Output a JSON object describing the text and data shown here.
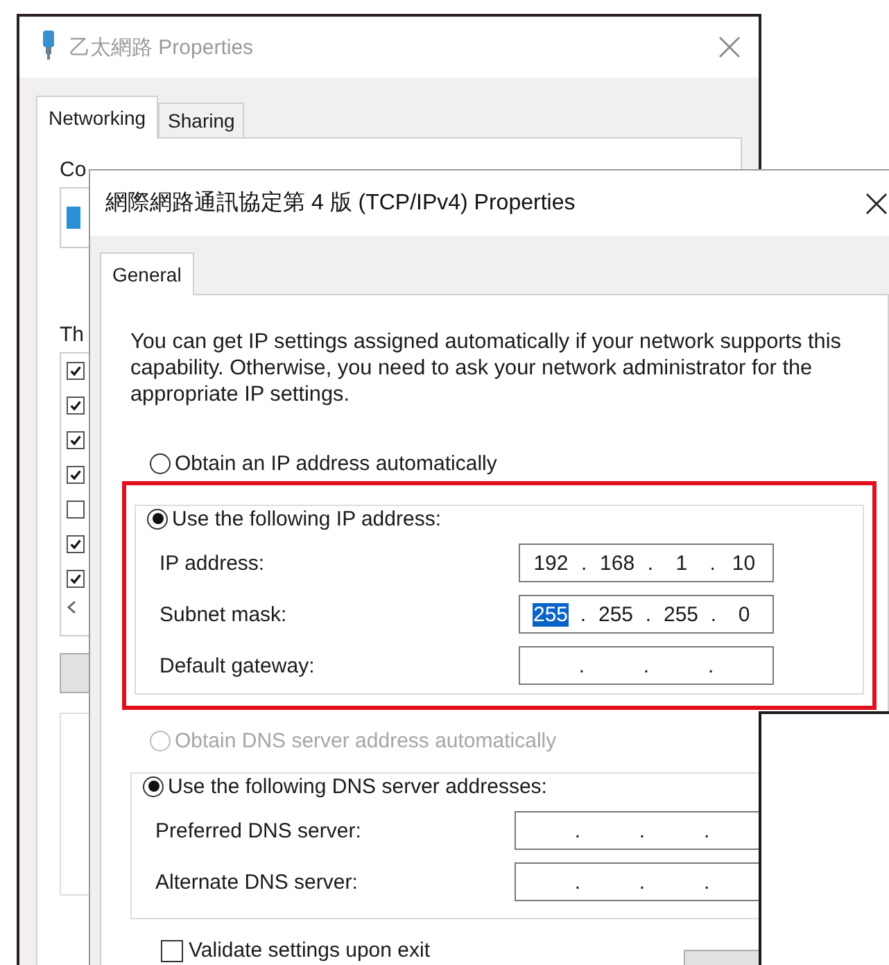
{
  "background_window": {
    "title": "乙太網路 Properties",
    "tabs": [
      {
        "label": "Networking",
        "selected": true
      },
      {
        "label": "Sharing",
        "selected": false
      }
    ],
    "labels": [
      "Co",
      "Th"
    ],
    "components": [
      {
        "checked": true
      },
      {
        "checked": true
      },
      {
        "checked": true
      },
      {
        "checked": true
      },
      {
        "checked": false
      },
      {
        "checked": true
      },
      {
        "checked": true
      }
    ]
  },
  "dialog": {
    "title": "網際網路通訊協定第 4 版 (TCP/IPv4) Properties",
    "tabs": [
      {
        "label": "General",
        "selected": true
      }
    ],
    "description": "You can get IP settings assigned automatically if your network supports this capability. Otherwise, you need to ask your network administrator for the appropriate IP settings.",
    "separator": ".",
    "highlighted": true,
    "ip_mode": [
      {
        "label": "Obtain an IP address automatically",
        "selected": false,
        "disabled": false
      },
      {
        "label": "Use the following IP address:",
        "selected": true,
        "disabled": false
      }
    ],
    "ip_fields": [
      {
        "label": "IP address:",
        "octets": [
          {
            "text": "192",
            "selected": false
          },
          {
            "text": "168",
            "selected": false
          },
          {
            "text": "1",
            "selected": false
          },
          {
            "text": "10",
            "selected": false
          }
        ]
      },
      {
        "label": "Subnet mask:",
        "octets": [
          {
            "text": "255",
            "selected": true
          },
          {
            "text": "255",
            "selected": false
          },
          {
            "text": "255",
            "selected": false
          },
          {
            "text": "0",
            "selected": false
          }
        ]
      },
      {
        "label": "Default gateway:"
      }
    ],
    "dns_mode": [
      {
        "label": "Obtain DNS server address automatically",
        "selected": false,
        "disabled": true
      },
      {
        "label": "Use the following DNS server addresses:",
        "selected": true,
        "disabled": false
      }
    ],
    "dns_fields": [
      {
        "label": "Preferred DNS server:"
      },
      {
        "label": "Alternate DNS server:"
      }
    ],
    "validate": {
      "label": "Validate settings upon exit",
      "checked": false
    }
  }
}
